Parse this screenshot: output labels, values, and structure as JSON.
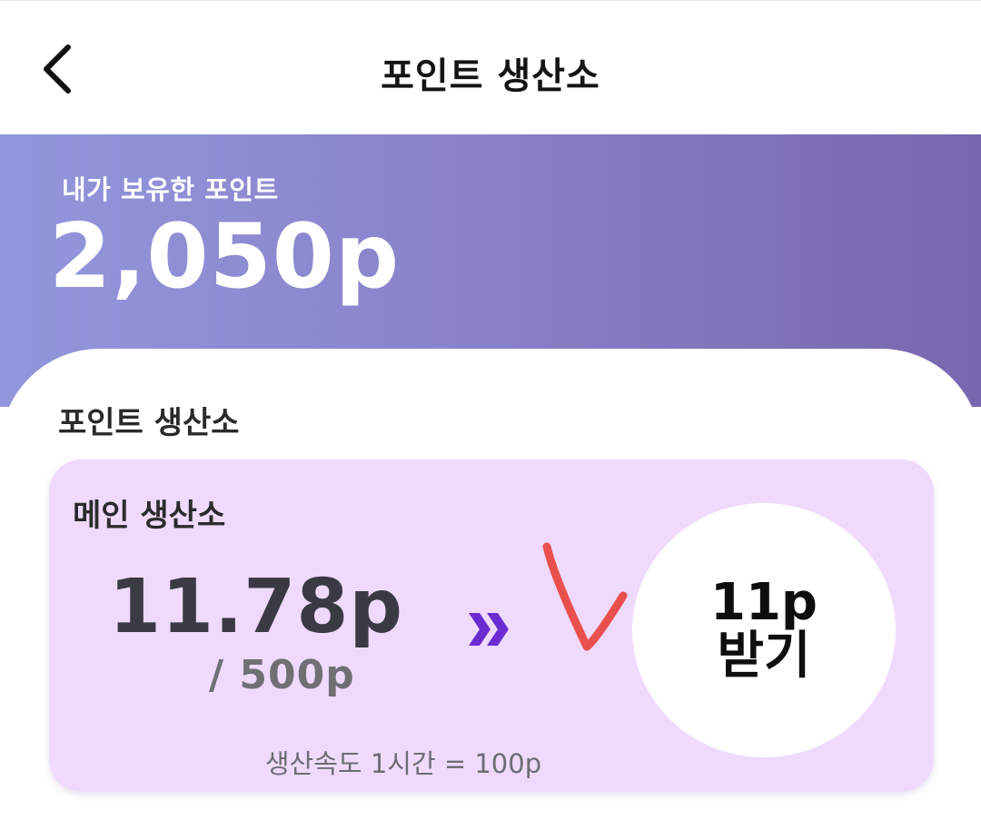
{
  "appbar": {
    "title": "포인트 생산소",
    "back_icon": "chevron-left-icon"
  },
  "hero": {
    "label": "내가 보유한 포인트",
    "points": "2,050p",
    "gradient": [
      "#9396dc",
      "#7767ae"
    ]
  },
  "section": {
    "title": "포인트 생산소"
  },
  "producer": {
    "title": "메인 생산소",
    "accumulated": "11.78p",
    "capacity": "/ 500p",
    "arrow_icon": "double-chevron-right-icon",
    "collect_button_line1": "11p",
    "collect_button_line2": "받기",
    "rate": "생산속도 1시간 = 100p",
    "card_color": "#efdafd",
    "accent_color": "#6a2bd1",
    "annotation_color": "#e8403a"
  }
}
